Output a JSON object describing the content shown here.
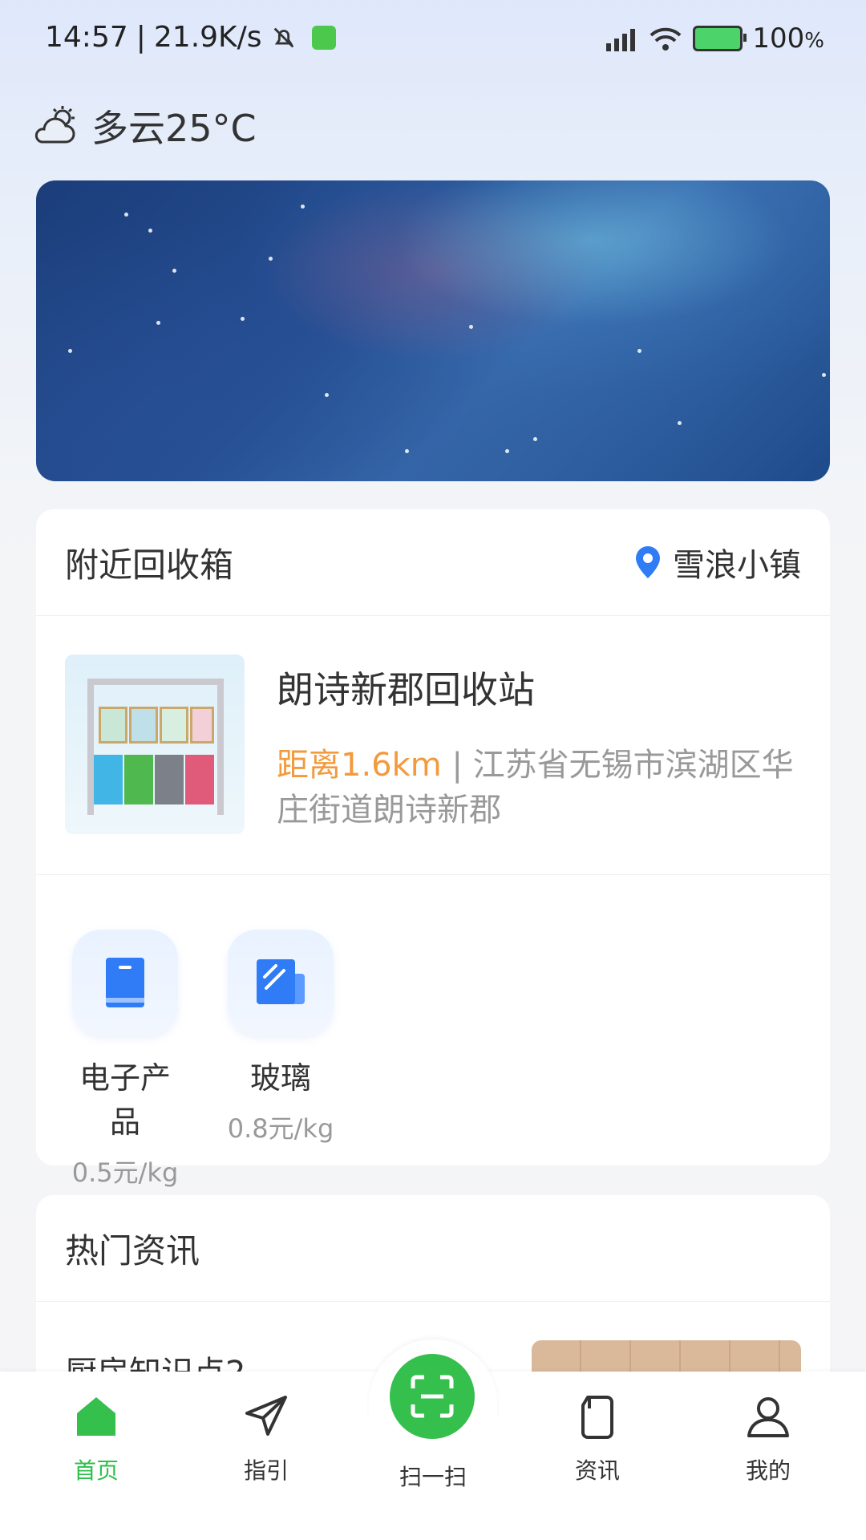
{
  "status_bar": {
    "time": "14:57",
    "speed": "21.9K/s",
    "battery": "100"
  },
  "weather": {
    "icon": "cloud-sun-icon",
    "text": "多云25°C"
  },
  "nearby": {
    "title": "附近回收箱",
    "location": "雪浪小镇",
    "station": {
      "name": "朗诗新郡回收站",
      "distance": "距离1.6km",
      "separator": "|",
      "address": "江苏省无锡市滨湖区华庄街道朗诗新郡"
    },
    "categories": [
      {
        "name": "电子产品",
        "price": "0.5元/kg",
        "icon": "book-icon"
      },
      {
        "name": "玻璃",
        "price": "0.8元/kg",
        "icon": "glass-icon"
      }
    ]
  },
  "news": {
    "title": "热门资讯",
    "items": [
      {
        "title": "厨房知识点2"
      }
    ]
  },
  "nav": {
    "items": [
      {
        "label": "首页",
        "icon": "home-icon",
        "active": true
      },
      {
        "label": "指引",
        "icon": "send-icon",
        "active": false
      },
      {
        "label": "扫一扫",
        "icon": "scan-icon",
        "active": false
      },
      {
        "label": "资讯",
        "icon": "document-icon",
        "active": false
      },
      {
        "label": "我的",
        "icon": "user-icon",
        "active": false
      }
    ]
  },
  "colors": {
    "accent_green": "#35c04e",
    "distance_orange": "#f29a3c",
    "location_blue": "#2f7cf6"
  }
}
